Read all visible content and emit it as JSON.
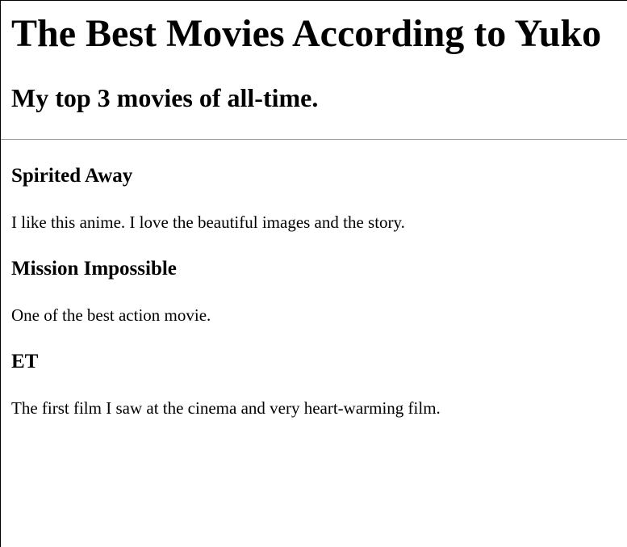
{
  "header": {
    "title": "The Best Movies According to Yuko",
    "subtitle": "My top 3 movies of all-time."
  },
  "movies": [
    {
      "title": "Spirited Away",
      "description": "I like this anime. I love the beautiful images and the story."
    },
    {
      "title": "Mission Impossible",
      "description": "One of the best action movie."
    },
    {
      "title": "ET",
      "description": "The first film I saw at the cinema and very heart-warming film."
    }
  ]
}
